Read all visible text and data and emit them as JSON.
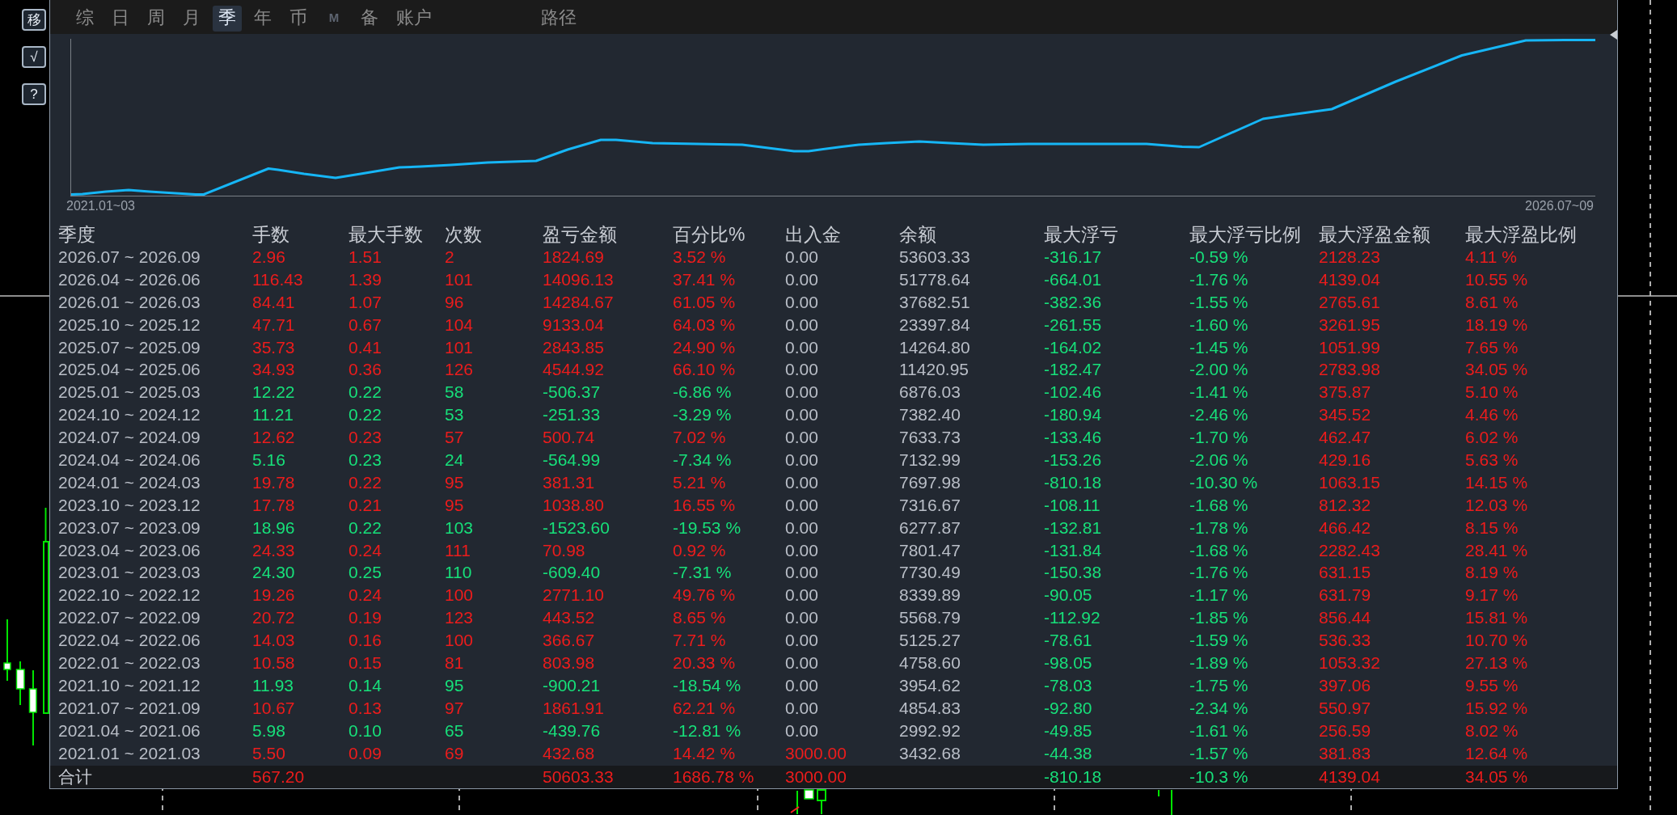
{
  "side_buttons": [
    {
      "label": "移"
    },
    {
      "label": "√"
    },
    {
      "label": "?"
    }
  ],
  "tabs": [
    {
      "label": "综",
      "selected": false,
      "disabled": false
    },
    {
      "label": "日",
      "selected": false,
      "disabled": false
    },
    {
      "label": "周",
      "selected": false,
      "disabled": false
    },
    {
      "label": "月",
      "selected": false,
      "disabled": false
    },
    {
      "label": "季",
      "selected": true,
      "disabled": false
    },
    {
      "label": "年",
      "selected": false,
      "disabled": false
    },
    {
      "label": "币",
      "selected": false,
      "disabled": false
    },
    {
      "label": "M",
      "selected": false,
      "disabled": true
    },
    {
      "label": "备",
      "selected": false,
      "disabled": false
    },
    {
      "label": "账户",
      "selected": false,
      "disabled": false
    }
  ],
  "path_tab": {
    "label": "路径",
    "selected": false
  },
  "equity_chart": {
    "start_label": "2021.01~03",
    "end_label": "2026.07~09"
  },
  "table": {
    "columns": [
      "季度",
      "手数",
      "最大手数",
      "次数",
      "盈亏金额",
      "百分比%",
      "出入金",
      "余额",
      "最大浮亏",
      "最大浮亏比例",
      "最大浮盈金额",
      "最大浮盈比例"
    ],
    "rows": [
      {
        "cells": [
          {
            "text": "2026.07 ~ 2026.09",
            "color": "#b9bec7"
          },
          {
            "text": "2.96",
            "color": "#ec1c1c"
          },
          {
            "text": "1.51",
            "color": "#ec1c1c"
          },
          {
            "text": "2",
            "color": "#ec1c1c"
          },
          {
            "text": "1824.69",
            "color": "#ec1c1c"
          },
          {
            "text": "3.52 %",
            "color": "#ec1c1c"
          },
          {
            "text": "0.00",
            "color": "#b9bec7"
          },
          {
            "text": "53603.33",
            "color": "#b9bec7"
          },
          {
            "text": "-316.17",
            "color": "#17e07a"
          },
          {
            "text": "-0.59 %",
            "color": "#17e07a"
          },
          {
            "text": "2128.23",
            "color": "#ec1c1c"
          },
          {
            "text": "4.11 %",
            "color": "#ec1c1c"
          }
        ]
      },
      {
        "cells": [
          {
            "text": "2026.04 ~ 2026.06",
            "color": "#b9bec7"
          },
          {
            "text": "116.43",
            "color": "#ec1c1c"
          },
          {
            "text": "1.39",
            "color": "#ec1c1c"
          },
          {
            "text": "101",
            "color": "#ec1c1c"
          },
          {
            "text": "14096.13",
            "color": "#ec1c1c"
          },
          {
            "text": "37.41 %",
            "color": "#ec1c1c"
          },
          {
            "text": "0.00",
            "color": "#b9bec7"
          },
          {
            "text": "51778.64",
            "color": "#b9bec7"
          },
          {
            "text": "-664.01",
            "color": "#17e07a"
          },
          {
            "text": "-1.76 %",
            "color": "#17e07a"
          },
          {
            "text": "4139.04",
            "color": "#ec1c1c"
          },
          {
            "text": "10.55 %",
            "color": "#ec1c1c"
          }
        ]
      },
      {
        "cells": [
          {
            "text": "2026.01 ~ 2026.03",
            "color": "#b9bec7"
          },
          {
            "text": "84.41",
            "color": "#ec1c1c"
          },
          {
            "text": "1.07",
            "color": "#ec1c1c"
          },
          {
            "text": "96",
            "color": "#ec1c1c"
          },
          {
            "text": "14284.67",
            "color": "#ec1c1c"
          },
          {
            "text": "61.05 %",
            "color": "#ec1c1c"
          },
          {
            "text": "0.00",
            "color": "#b9bec7"
          },
          {
            "text": "37682.51",
            "color": "#b9bec7"
          },
          {
            "text": "-382.36",
            "color": "#17e07a"
          },
          {
            "text": "-1.55 %",
            "color": "#17e07a"
          },
          {
            "text": "2765.61",
            "color": "#ec1c1c"
          },
          {
            "text": "8.61 %",
            "color": "#ec1c1c"
          }
        ]
      },
      {
        "cells": [
          {
            "text": "2025.10 ~ 2025.12",
            "color": "#b9bec7"
          },
          {
            "text": "47.71",
            "color": "#ec1c1c"
          },
          {
            "text": "0.67",
            "color": "#ec1c1c"
          },
          {
            "text": "104",
            "color": "#ec1c1c"
          },
          {
            "text": "9133.04",
            "color": "#ec1c1c"
          },
          {
            "text": "64.03 %",
            "color": "#ec1c1c"
          },
          {
            "text": "0.00",
            "color": "#b9bec7"
          },
          {
            "text": "23397.84",
            "color": "#b9bec7"
          },
          {
            "text": "-261.55",
            "color": "#17e07a"
          },
          {
            "text": "-1.60 %",
            "color": "#17e07a"
          },
          {
            "text": "3261.95",
            "color": "#ec1c1c"
          },
          {
            "text": "18.19 %",
            "color": "#ec1c1c"
          }
        ]
      },
      {
        "cells": [
          {
            "text": "2025.07 ~ 2025.09",
            "color": "#b9bec7"
          },
          {
            "text": "35.73",
            "color": "#ec1c1c"
          },
          {
            "text": "0.41",
            "color": "#ec1c1c"
          },
          {
            "text": "101",
            "color": "#ec1c1c"
          },
          {
            "text": "2843.85",
            "color": "#ec1c1c"
          },
          {
            "text": "24.90 %",
            "color": "#ec1c1c"
          },
          {
            "text": "0.00",
            "color": "#b9bec7"
          },
          {
            "text": "14264.80",
            "color": "#b9bec7"
          },
          {
            "text": "-164.02",
            "color": "#17e07a"
          },
          {
            "text": "-1.45 %",
            "color": "#17e07a"
          },
          {
            "text": "1051.99",
            "color": "#ec1c1c"
          },
          {
            "text": "7.65 %",
            "color": "#ec1c1c"
          }
        ]
      },
      {
        "cells": [
          {
            "text": "2025.04 ~ 2025.06",
            "color": "#b9bec7"
          },
          {
            "text": "34.93",
            "color": "#ec1c1c"
          },
          {
            "text": "0.36",
            "color": "#ec1c1c"
          },
          {
            "text": "126",
            "color": "#ec1c1c"
          },
          {
            "text": "4544.92",
            "color": "#ec1c1c"
          },
          {
            "text": "66.10 %",
            "color": "#ec1c1c"
          },
          {
            "text": "0.00",
            "color": "#b9bec7"
          },
          {
            "text": "11420.95",
            "color": "#b9bec7"
          },
          {
            "text": "-182.47",
            "color": "#17e07a"
          },
          {
            "text": "-2.00 %",
            "color": "#17e07a"
          },
          {
            "text": "2783.98",
            "color": "#ec1c1c"
          },
          {
            "text": "34.05 %",
            "color": "#ec1c1c"
          }
        ]
      },
      {
        "cells": [
          {
            "text": "2025.01 ~ 2025.03",
            "color": "#b9bec7"
          },
          {
            "text": "12.22",
            "color": "#17e07a"
          },
          {
            "text": "0.22",
            "color": "#17e07a"
          },
          {
            "text": "58",
            "color": "#17e07a"
          },
          {
            "text": "-506.37",
            "color": "#17e07a"
          },
          {
            "text": "-6.86 %",
            "color": "#17e07a"
          },
          {
            "text": "0.00",
            "color": "#b9bec7"
          },
          {
            "text": "6876.03",
            "color": "#b9bec7"
          },
          {
            "text": "-102.46",
            "color": "#17e07a"
          },
          {
            "text": "-1.41 %",
            "color": "#17e07a"
          },
          {
            "text": "375.87",
            "color": "#ec1c1c"
          },
          {
            "text": "5.10 %",
            "color": "#ec1c1c"
          }
        ]
      },
      {
        "cells": [
          {
            "text": "2024.10 ~ 2024.12",
            "color": "#b9bec7"
          },
          {
            "text": "11.21",
            "color": "#17e07a"
          },
          {
            "text": "0.22",
            "color": "#17e07a"
          },
          {
            "text": "53",
            "color": "#17e07a"
          },
          {
            "text": "-251.33",
            "color": "#17e07a"
          },
          {
            "text": "-3.29 %",
            "color": "#17e07a"
          },
          {
            "text": "0.00",
            "color": "#b9bec7"
          },
          {
            "text": "7382.40",
            "color": "#b9bec7"
          },
          {
            "text": "-180.94",
            "color": "#17e07a"
          },
          {
            "text": "-2.46 %",
            "color": "#17e07a"
          },
          {
            "text": "345.52",
            "color": "#ec1c1c"
          },
          {
            "text": "4.46 %",
            "color": "#ec1c1c"
          }
        ]
      },
      {
        "cells": [
          {
            "text": "2024.07 ~ 2024.09",
            "color": "#b9bec7"
          },
          {
            "text": "12.62",
            "color": "#ec1c1c"
          },
          {
            "text": "0.23",
            "color": "#ec1c1c"
          },
          {
            "text": "57",
            "color": "#ec1c1c"
          },
          {
            "text": "500.74",
            "color": "#ec1c1c"
          },
          {
            "text": "7.02 %",
            "color": "#ec1c1c"
          },
          {
            "text": "0.00",
            "color": "#b9bec7"
          },
          {
            "text": "7633.73",
            "color": "#b9bec7"
          },
          {
            "text": "-133.46",
            "color": "#17e07a"
          },
          {
            "text": "-1.70 %",
            "color": "#17e07a"
          },
          {
            "text": "462.47",
            "color": "#ec1c1c"
          },
          {
            "text": "6.02 %",
            "color": "#ec1c1c"
          }
        ]
      },
      {
        "cells": [
          {
            "text": "2024.04 ~ 2024.06",
            "color": "#b9bec7"
          },
          {
            "text": "5.16",
            "color": "#17e07a"
          },
          {
            "text": "0.23",
            "color": "#17e07a"
          },
          {
            "text": "24",
            "color": "#17e07a"
          },
          {
            "text": "-564.99",
            "color": "#17e07a"
          },
          {
            "text": "-7.34 %",
            "color": "#17e07a"
          },
          {
            "text": "0.00",
            "color": "#b9bec7"
          },
          {
            "text": "7132.99",
            "color": "#b9bec7"
          },
          {
            "text": "-153.26",
            "color": "#17e07a"
          },
          {
            "text": "-2.06 %",
            "color": "#17e07a"
          },
          {
            "text": "429.16",
            "color": "#ec1c1c"
          },
          {
            "text": "5.63 %",
            "color": "#ec1c1c"
          }
        ]
      },
      {
        "cells": [
          {
            "text": "2024.01 ~ 2024.03",
            "color": "#b9bec7"
          },
          {
            "text": "19.78",
            "color": "#ec1c1c"
          },
          {
            "text": "0.22",
            "color": "#ec1c1c"
          },
          {
            "text": "95",
            "color": "#ec1c1c"
          },
          {
            "text": "381.31",
            "color": "#ec1c1c"
          },
          {
            "text": "5.21 %",
            "color": "#ec1c1c"
          },
          {
            "text": "0.00",
            "color": "#b9bec7"
          },
          {
            "text": "7697.98",
            "color": "#b9bec7"
          },
          {
            "text": "-810.18",
            "color": "#17e07a"
          },
          {
            "text": "-10.30 %",
            "color": "#17e07a"
          },
          {
            "text": "1063.15",
            "color": "#ec1c1c"
          },
          {
            "text": "14.15 %",
            "color": "#ec1c1c"
          }
        ]
      },
      {
        "cells": [
          {
            "text": "2023.10 ~ 2023.12",
            "color": "#b9bec7"
          },
          {
            "text": "17.78",
            "color": "#ec1c1c"
          },
          {
            "text": "0.21",
            "color": "#ec1c1c"
          },
          {
            "text": "95",
            "color": "#ec1c1c"
          },
          {
            "text": "1038.80",
            "color": "#ec1c1c"
          },
          {
            "text": "16.55 %",
            "color": "#ec1c1c"
          },
          {
            "text": "0.00",
            "color": "#b9bec7"
          },
          {
            "text": "7316.67",
            "color": "#b9bec7"
          },
          {
            "text": "-108.11",
            "color": "#17e07a"
          },
          {
            "text": "-1.68 %",
            "color": "#17e07a"
          },
          {
            "text": "812.32",
            "color": "#ec1c1c"
          },
          {
            "text": "12.03 %",
            "color": "#ec1c1c"
          }
        ]
      },
      {
        "cells": [
          {
            "text": "2023.07 ~ 2023.09",
            "color": "#b9bec7"
          },
          {
            "text": "18.96",
            "color": "#17e07a"
          },
          {
            "text": "0.22",
            "color": "#17e07a"
          },
          {
            "text": "103",
            "color": "#17e07a"
          },
          {
            "text": "-1523.60",
            "color": "#17e07a"
          },
          {
            "text": "-19.53 %",
            "color": "#17e07a"
          },
          {
            "text": "0.00",
            "color": "#b9bec7"
          },
          {
            "text": "6277.87",
            "color": "#b9bec7"
          },
          {
            "text": "-132.81",
            "color": "#17e07a"
          },
          {
            "text": "-1.78 %",
            "color": "#17e07a"
          },
          {
            "text": "466.42",
            "color": "#ec1c1c"
          },
          {
            "text": "8.15 %",
            "color": "#ec1c1c"
          }
        ]
      },
      {
        "cells": [
          {
            "text": "2023.04 ~ 2023.06",
            "color": "#b9bec7"
          },
          {
            "text": "24.33",
            "color": "#ec1c1c"
          },
          {
            "text": "0.24",
            "color": "#ec1c1c"
          },
          {
            "text": "111",
            "color": "#ec1c1c"
          },
          {
            "text": "70.98",
            "color": "#ec1c1c"
          },
          {
            "text": "0.92 %",
            "color": "#ec1c1c"
          },
          {
            "text": "0.00",
            "color": "#b9bec7"
          },
          {
            "text": "7801.47",
            "color": "#b9bec7"
          },
          {
            "text": "-131.84",
            "color": "#17e07a"
          },
          {
            "text": "-1.68 %",
            "color": "#17e07a"
          },
          {
            "text": "2282.43",
            "color": "#ec1c1c"
          },
          {
            "text": "28.41 %",
            "color": "#ec1c1c"
          }
        ]
      },
      {
        "cells": [
          {
            "text": "2023.01 ~ 2023.03",
            "color": "#b9bec7"
          },
          {
            "text": "24.30",
            "color": "#17e07a"
          },
          {
            "text": "0.25",
            "color": "#17e07a"
          },
          {
            "text": "110",
            "color": "#17e07a"
          },
          {
            "text": "-609.40",
            "color": "#17e07a"
          },
          {
            "text": "-7.31 %",
            "color": "#17e07a"
          },
          {
            "text": "0.00",
            "color": "#b9bec7"
          },
          {
            "text": "7730.49",
            "color": "#b9bec7"
          },
          {
            "text": "-150.38",
            "color": "#17e07a"
          },
          {
            "text": "-1.76 %",
            "color": "#17e07a"
          },
          {
            "text": "631.15",
            "color": "#ec1c1c"
          },
          {
            "text": "8.19 %",
            "color": "#ec1c1c"
          }
        ]
      },
      {
        "cells": [
          {
            "text": "2022.10 ~ 2022.12",
            "color": "#b9bec7"
          },
          {
            "text": "19.26",
            "color": "#ec1c1c"
          },
          {
            "text": "0.24",
            "color": "#ec1c1c"
          },
          {
            "text": "100",
            "color": "#ec1c1c"
          },
          {
            "text": "2771.10",
            "color": "#ec1c1c"
          },
          {
            "text": "49.76 %",
            "color": "#ec1c1c"
          },
          {
            "text": "0.00",
            "color": "#b9bec7"
          },
          {
            "text": "8339.89",
            "color": "#b9bec7"
          },
          {
            "text": "-90.05",
            "color": "#17e07a"
          },
          {
            "text": "-1.17 %",
            "color": "#17e07a"
          },
          {
            "text": "631.79",
            "color": "#ec1c1c"
          },
          {
            "text": "9.17 %",
            "color": "#ec1c1c"
          }
        ]
      },
      {
        "cells": [
          {
            "text": "2022.07 ~ 2022.09",
            "color": "#b9bec7"
          },
          {
            "text": "20.72",
            "color": "#ec1c1c"
          },
          {
            "text": "0.19",
            "color": "#ec1c1c"
          },
          {
            "text": "123",
            "color": "#ec1c1c"
          },
          {
            "text": "443.52",
            "color": "#ec1c1c"
          },
          {
            "text": "8.65 %",
            "color": "#ec1c1c"
          },
          {
            "text": "0.00",
            "color": "#b9bec7"
          },
          {
            "text": "5568.79",
            "color": "#b9bec7"
          },
          {
            "text": "-112.92",
            "color": "#17e07a"
          },
          {
            "text": "-1.85 %",
            "color": "#17e07a"
          },
          {
            "text": "856.44",
            "color": "#ec1c1c"
          },
          {
            "text": "15.81 %",
            "color": "#ec1c1c"
          }
        ]
      },
      {
        "cells": [
          {
            "text": "2022.04 ~ 2022.06",
            "color": "#b9bec7"
          },
          {
            "text": "14.03",
            "color": "#ec1c1c"
          },
          {
            "text": "0.16",
            "color": "#ec1c1c"
          },
          {
            "text": "100",
            "color": "#ec1c1c"
          },
          {
            "text": "366.67",
            "color": "#ec1c1c"
          },
          {
            "text": "7.71 %",
            "color": "#ec1c1c"
          },
          {
            "text": "0.00",
            "color": "#b9bec7"
          },
          {
            "text": "5125.27",
            "color": "#b9bec7"
          },
          {
            "text": "-78.61",
            "color": "#17e07a"
          },
          {
            "text": "-1.59 %",
            "color": "#17e07a"
          },
          {
            "text": "536.33",
            "color": "#ec1c1c"
          },
          {
            "text": "10.70 %",
            "color": "#ec1c1c"
          }
        ]
      },
      {
        "cells": [
          {
            "text": "2022.01 ~ 2022.03",
            "color": "#b9bec7"
          },
          {
            "text": "10.58",
            "color": "#ec1c1c"
          },
          {
            "text": "0.15",
            "color": "#ec1c1c"
          },
          {
            "text": "81",
            "color": "#ec1c1c"
          },
          {
            "text": "803.98",
            "color": "#ec1c1c"
          },
          {
            "text": "20.33 %",
            "color": "#ec1c1c"
          },
          {
            "text": "0.00",
            "color": "#b9bec7"
          },
          {
            "text": "4758.60",
            "color": "#b9bec7"
          },
          {
            "text": "-98.05",
            "color": "#17e07a"
          },
          {
            "text": "-1.89 %",
            "color": "#17e07a"
          },
          {
            "text": "1053.32",
            "color": "#ec1c1c"
          },
          {
            "text": "27.13 %",
            "color": "#ec1c1c"
          }
        ]
      },
      {
        "cells": [
          {
            "text": "2021.10 ~ 2021.12",
            "color": "#b9bec7"
          },
          {
            "text": "11.93",
            "color": "#17e07a"
          },
          {
            "text": "0.14",
            "color": "#17e07a"
          },
          {
            "text": "95",
            "color": "#17e07a"
          },
          {
            "text": "-900.21",
            "color": "#17e07a"
          },
          {
            "text": "-18.54 %",
            "color": "#17e07a"
          },
          {
            "text": "0.00",
            "color": "#b9bec7"
          },
          {
            "text": "3954.62",
            "color": "#b9bec7"
          },
          {
            "text": "-78.03",
            "color": "#17e07a"
          },
          {
            "text": "-1.75 %",
            "color": "#17e07a"
          },
          {
            "text": "397.06",
            "color": "#ec1c1c"
          },
          {
            "text": "9.55 %",
            "color": "#ec1c1c"
          }
        ]
      },
      {
        "cells": [
          {
            "text": "2021.07 ~ 2021.09",
            "color": "#b9bec7"
          },
          {
            "text": "10.67",
            "color": "#ec1c1c"
          },
          {
            "text": "0.13",
            "color": "#ec1c1c"
          },
          {
            "text": "97",
            "color": "#ec1c1c"
          },
          {
            "text": "1861.91",
            "color": "#ec1c1c"
          },
          {
            "text": "62.21 %",
            "color": "#ec1c1c"
          },
          {
            "text": "0.00",
            "color": "#b9bec7"
          },
          {
            "text": "4854.83",
            "color": "#b9bec7"
          },
          {
            "text": "-92.80",
            "color": "#17e07a"
          },
          {
            "text": "-2.34 %",
            "color": "#17e07a"
          },
          {
            "text": "550.97",
            "color": "#ec1c1c"
          },
          {
            "text": "15.92 %",
            "color": "#ec1c1c"
          }
        ]
      },
      {
        "cells": [
          {
            "text": "2021.04 ~ 2021.06",
            "color": "#b9bec7"
          },
          {
            "text": "5.98",
            "color": "#17e07a"
          },
          {
            "text": "0.10",
            "color": "#17e07a"
          },
          {
            "text": "65",
            "color": "#17e07a"
          },
          {
            "text": "-439.76",
            "color": "#17e07a"
          },
          {
            "text": "-12.81 %",
            "color": "#17e07a"
          },
          {
            "text": "0.00",
            "color": "#b9bec7"
          },
          {
            "text": "2992.92",
            "color": "#b9bec7"
          },
          {
            "text": "-49.85",
            "color": "#17e07a"
          },
          {
            "text": "-1.61 %",
            "color": "#17e07a"
          },
          {
            "text": "256.59",
            "color": "#ec1c1c"
          },
          {
            "text": "8.02 %",
            "color": "#ec1c1c"
          }
        ]
      },
      {
        "cells": [
          {
            "text": "2021.01 ~ 2021.03",
            "color": "#b9bec7"
          },
          {
            "text": "5.50",
            "color": "#ec1c1c"
          },
          {
            "text": "0.09",
            "color": "#ec1c1c"
          },
          {
            "text": "69",
            "color": "#ec1c1c"
          },
          {
            "text": "432.68",
            "color": "#ec1c1c"
          },
          {
            "text": "14.42 %",
            "color": "#ec1c1c"
          },
          {
            "text": "3000.00",
            "color": "#ec1c1c"
          },
          {
            "text": "3432.68",
            "color": "#b9bec7"
          },
          {
            "text": "-44.38",
            "color": "#17e07a"
          },
          {
            "text": "-1.57 %",
            "color": "#17e07a"
          },
          {
            "text": "381.83",
            "color": "#ec1c1c"
          },
          {
            "text": "12.64 %",
            "color": "#ec1c1c"
          }
        ]
      }
    ],
    "total": {
      "cells": [
        {
          "text": "合计",
          "color": "#c9cdd4"
        },
        {
          "text": "567.20",
          "color": "#ec1c1c"
        },
        null,
        null,
        {
          "text": "50603.33",
          "color": "#ec1c1c"
        },
        {
          "text": "1686.78 %",
          "color": "#ec1c1c"
        },
        {
          "text": "3000.00",
          "color": "#ec1c1c"
        },
        null,
        {
          "text": "-810.18",
          "color": "#17e07a"
        },
        {
          "text": "-10.3 %",
          "color": "#17e07a"
        },
        {
          "text": "4139.04",
          "color": "#ec1c1c"
        },
        {
          "text": "34.05 %",
          "color": "#ec1c1c"
        }
      ]
    }
  }
}
